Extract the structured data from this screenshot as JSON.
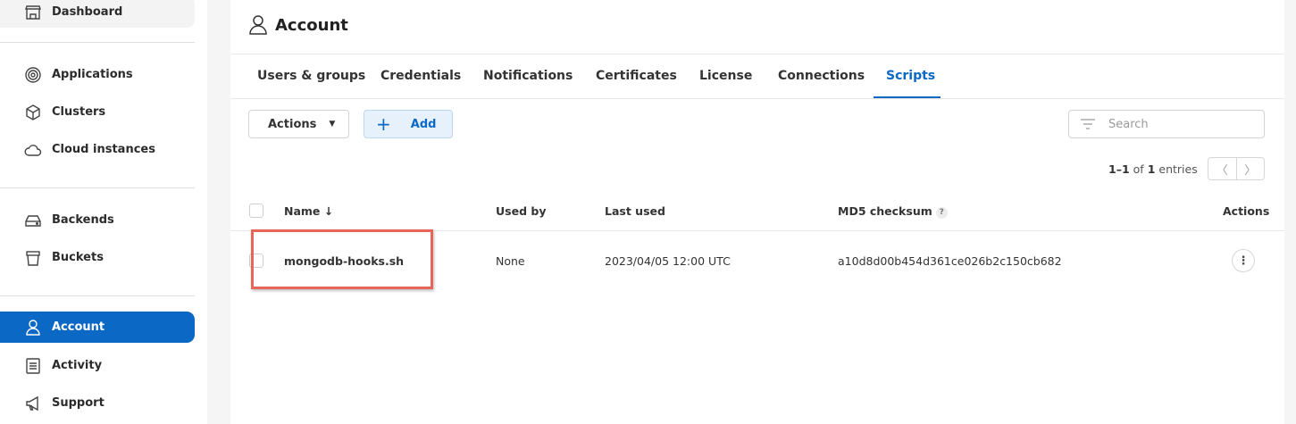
{
  "sidebar": {
    "items": [
      {
        "label": "Dashboard",
        "icon": "storefront-icon"
      },
      {
        "label": "Applications",
        "icon": "target-icon"
      },
      {
        "label": "Clusters",
        "icon": "cube-icon"
      },
      {
        "label": "Cloud instances",
        "icon": "cloud-icon"
      },
      {
        "label": "Backends",
        "icon": "hard-drive-icon"
      },
      {
        "label": "Buckets",
        "icon": "bucket-icon"
      },
      {
        "label": "Account",
        "icon": "user-icon",
        "active": true
      },
      {
        "label": "Activity",
        "icon": "list-icon"
      },
      {
        "label": "Support",
        "icon": "megaphone-icon"
      }
    ]
  },
  "header": {
    "title": "Account"
  },
  "tabs": [
    {
      "label": "Users & groups"
    },
    {
      "label": "Credentials"
    },
    {
      "label": "Notifications"
    },
    {
      "label": "Certificates"
    },
    {
      "label": "License"
    },
    {
      "label": "Connections"
    },
    {
      "label": "Scripts",
      "active": true
    }
  ],
  "toolbar": {
    "actions_label": "Actions",
    "add_label": "Add",
    "search_placeholder": "Search"
  },
  "pagination": {
    "range": "1–1",
    "of": "of",
    "total": "1",
    "suffix": "entries"
  },
  "table": {
    "columns": {
      "name": "Name ↓",
      "used_by": "Used by",
      "last_used": "Last used",
      "md5": "MD5 checksum",
      "actions": "Actions"
    },
    "rows": [
      {
        "name": "mongodb-hooks.sh",
        "used_by": "None",
        "last_used": "2023/04/05 12:00 UTC",
        "md5": "a10d8d00b454d361ce026b2c150cb682"
      }
    ]
  },
  "colors": {
    "accent": "#0b68c4",
    "highlight_border": "#e8655a"
  }
}
